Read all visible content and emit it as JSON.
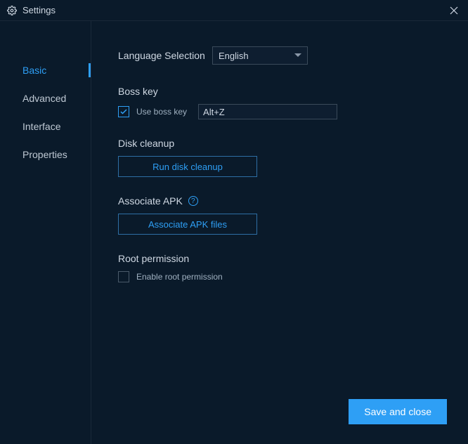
{
  "window": {
    "title": "Settings"
  },
  "sidebar": {
    "items": [
      {
        "label": "Basic",
        "active": true
      },
      {
        "label": "Advanced",
        "active": false
      },
      {
        "label": "Interface",
        "active": false
      },
      {
        "label": "Properties",
        "active": false
      }
    ]
  },
  "settings": {
    "language": {
      "label": "Language Selection",
      "value": "English"
    },
    "bosskey": {
      "title": "Boss key",
      "checkbox_label": "Use boss key",
      "checked": true,
      "shortcut": "Alt+Z"
    },
    "disk": {
      "title": "Disk cleanup",
      "button": "Run disk cleanup"
    },
    "apk": {
      "title": "Associate APK",
      "button": "Associate APK files"
    },
    "root": {
      "title": "Root permission",
      "checkbox_label": "Enable root permission",
      "checked": false
    }
  },
  "footer": {
    "save": "Save and close"
  }
}
